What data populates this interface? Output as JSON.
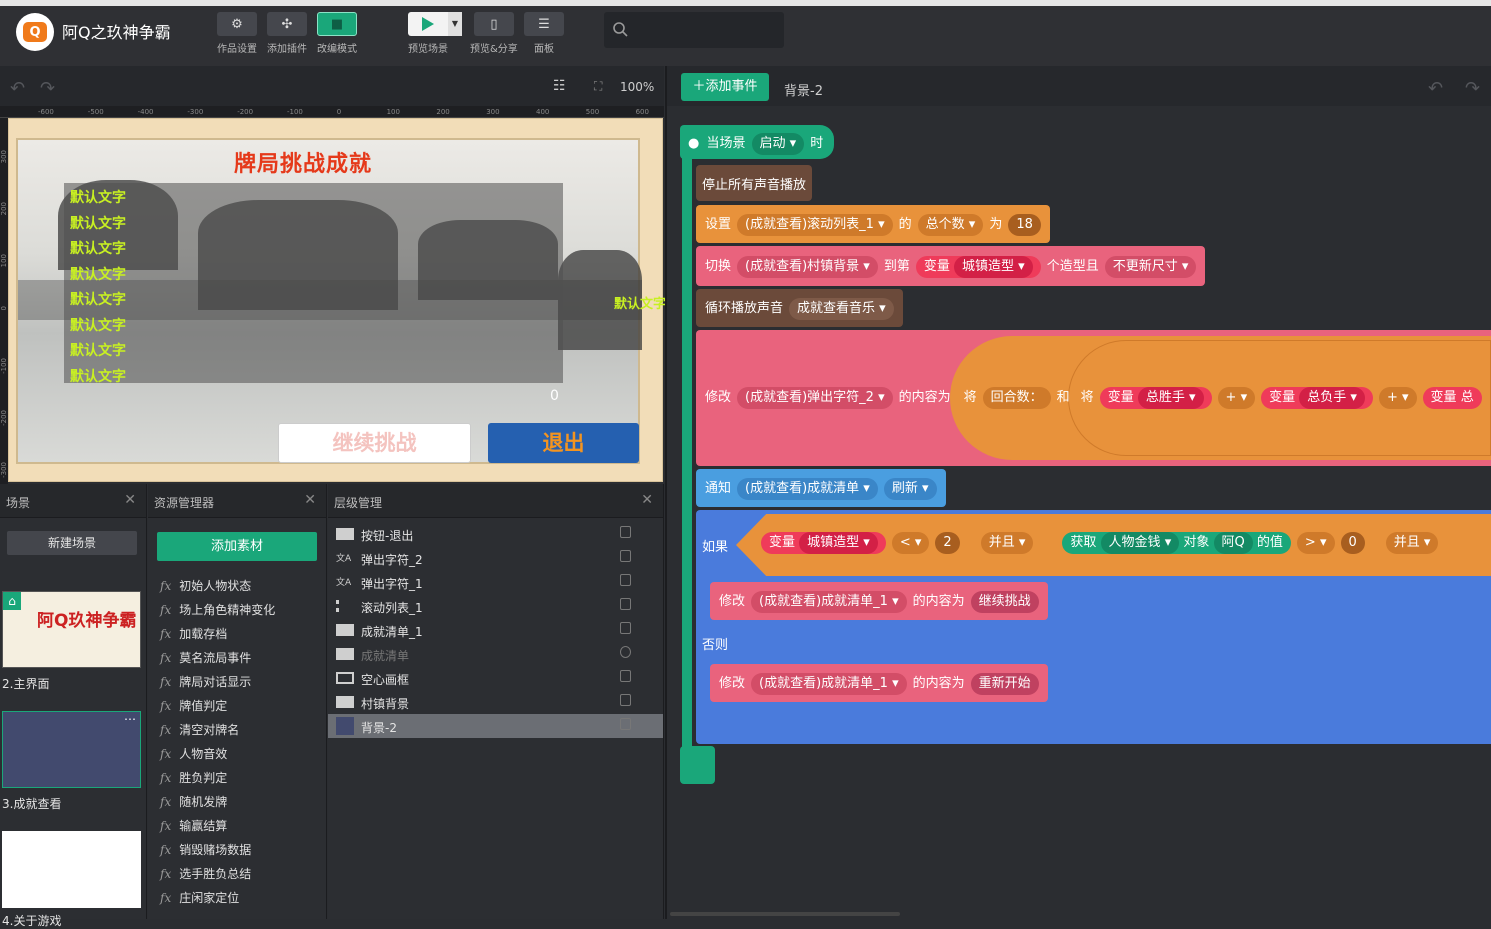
{
  "app": {
    "title": "阿Q之玖神争霸",
    "logo_char": "Q"
  },
  "toolbar": {
    "works_settings": "作品设置",
    "add_plugin": "添加插件",
    "edit_mode": "改编模式",
    "preview_scene": "预览场景",
    "preview_share": "预览&分享",
    "panel": "面板"
  },
  "search": {
    "placeholder": ""
  },
  "stage_toolbar": {
    "zoom": "100%"
  },
  "ruler": {
    "top_ticks": [
      "-600",
      "-500",
      "-400",
      "-300",
      "-200",
      "-100",
      "0",
      "100",
      "200",
      "300",
      "400",
      "500",
      "600"
    ],
    "left_ticks": [
      "300",
      "200",
      "100",
      "0",
      "-100",
      "-200",
      "-300"
    ]
  },
  "stage": {
    "title": "牌局挑战成就",
    "list_rows": [
      "默认文字",
      "默认文字",
      "默认文字",
      "默认文字",
      "默认文字",
      "默认文字",
      "默认文字",
      "默认文字"
    ],
    "side_text": "默认文字",
    "zero": "0",
    "continue_btn": "继续挑战",
    "exit_btn": "退出"
  },
  "scene_panel": {
    "title": "场景",
    "new_scene": "新建场景",
    "scenes": [
      {
        "label": "2.主界面",
        "thumb_title": "阿Q玖神争霸"
      },
      {
        "label": "3.成就查看"
      },
      {
        "label": "4.关于游戏"
      }
    ]
  },
  "resource_panel": {
    "title": "资源管理器",
    "add_material": "添加素材",
    "items": [
      "初始人物状态",
      "场上角色精神变化",
      "加载存档",
      "莫名流局事件",
      "牌局对话显示",
      "牌值判定",
      "清空对牌名",
      "人物音效",
      "胜负判定",
      "随机发牌",
      "输赢结算",
      "销毁赌场数据",
      "选手胜负总结",
      "庄闲家定位"
    ]
  },
  "layer_panel": {
    "title": "层级管理",
    "items": [
      {
        "name": "按钮-退出",
        "icon": "button-icon"
      },
      {
        "name": "弹出字符_2",
        "icon": "text-icon"
      },
      {
        "name": "弹出字符_1",
        "icon": "text-icon"
      },
      {
        "name": "滚动列表_1",
        "icon": "list-icon"
      },
      {
        "name": "成就清单_1",
        "icon": "rect-icon"
      },
      {
        "name": "成就清单",
        "icon": "rect-icon",
        "hidden": true
      },
      {
        "name": "空心画框",
        "icon": "frame-icon"
      },
      {
        "name": "村镇背景",
        "icon": "image-icon"
      },
      {
        "name": "背景-2",
        "icon": "bg-icon",
        "selected": true
      }
    ]
  },
  "editor": {
    "add_event": "添加事件",
    "tab": "背景-2",
    "event": {
      "when": "当场景",
      "trigger": "启动",
      "suffix": "时"
    },
    "stop_sound": "停止所有声音播放",
    "set_block": {
      "verb": "设置",
      "target": "(成就查看)滚动列表_1",
      "of": "的",
      "prop": "总个数",
      "as": "为",
      "value": "18"
    },
    "switch_block": {
      "verb": "切换",
      "target": "(成就查看)村镇背景",
      "to": "到第",
      "var": "变量",
      "var_name": "城镇造型",
      "suffix": "个造型且",
      "option": "不更新尺寸"
    },
    "loop_sound": {
      "verb": "循环播放声音",
      "sound": "成就查看音乐"
    },
    "modify_block": {
      "verb": "修改",
      "target": "(成就查看)弹出字符_2",
      "content": "的内容为",
      "join": "将",
      "text": "回合数：",
      "and": "和",
      "join2": "将",
      "var": "变量",
      "v1": "总胜手",
      "op": "+",
      "v2": "总负手",
      "op2": "+",
      "var3": "变量",
      "v3": "总"
    },
    "notify_block": {
      "verb": "通知",
      "target": "(成就查看)成就清单",
      "action": "刷新"
    },
    "if_block": {
      "if": "如果",
      "var": "变量",
      "var_name": "城镇造型",
      "cmp": "<",
      "value": "2",
      "and": "并且",
      "get": "获取",
      "money": "人物金钱",
      "obj": "对象",
      "obj_name": "阿Q",
      "of_val": "的值",
      "cmp2": ">",
      "value2": "0",
      "and2": "并且"
    },
    "modify_then": {
      "verb": "修改",
      "target": "(成就查看)成就清单_1",
      "content": "的内容为",
      "value": "继续挑战"
    },
    "else": "否则",
    "modify_else": {
      "verb": "修改",
      "target": "(成就查看)成就清单_1",
      "content": "的内容为",
      "value": "重新开始"
    }
  },
  "colors": {
    "accent": "#1aa77a",
    "orange": "#e8923b",
    "pink": "#e9637d",
    "blue": "#4a7bdc",
    "brown": "#6b4a3a"
  }
}
